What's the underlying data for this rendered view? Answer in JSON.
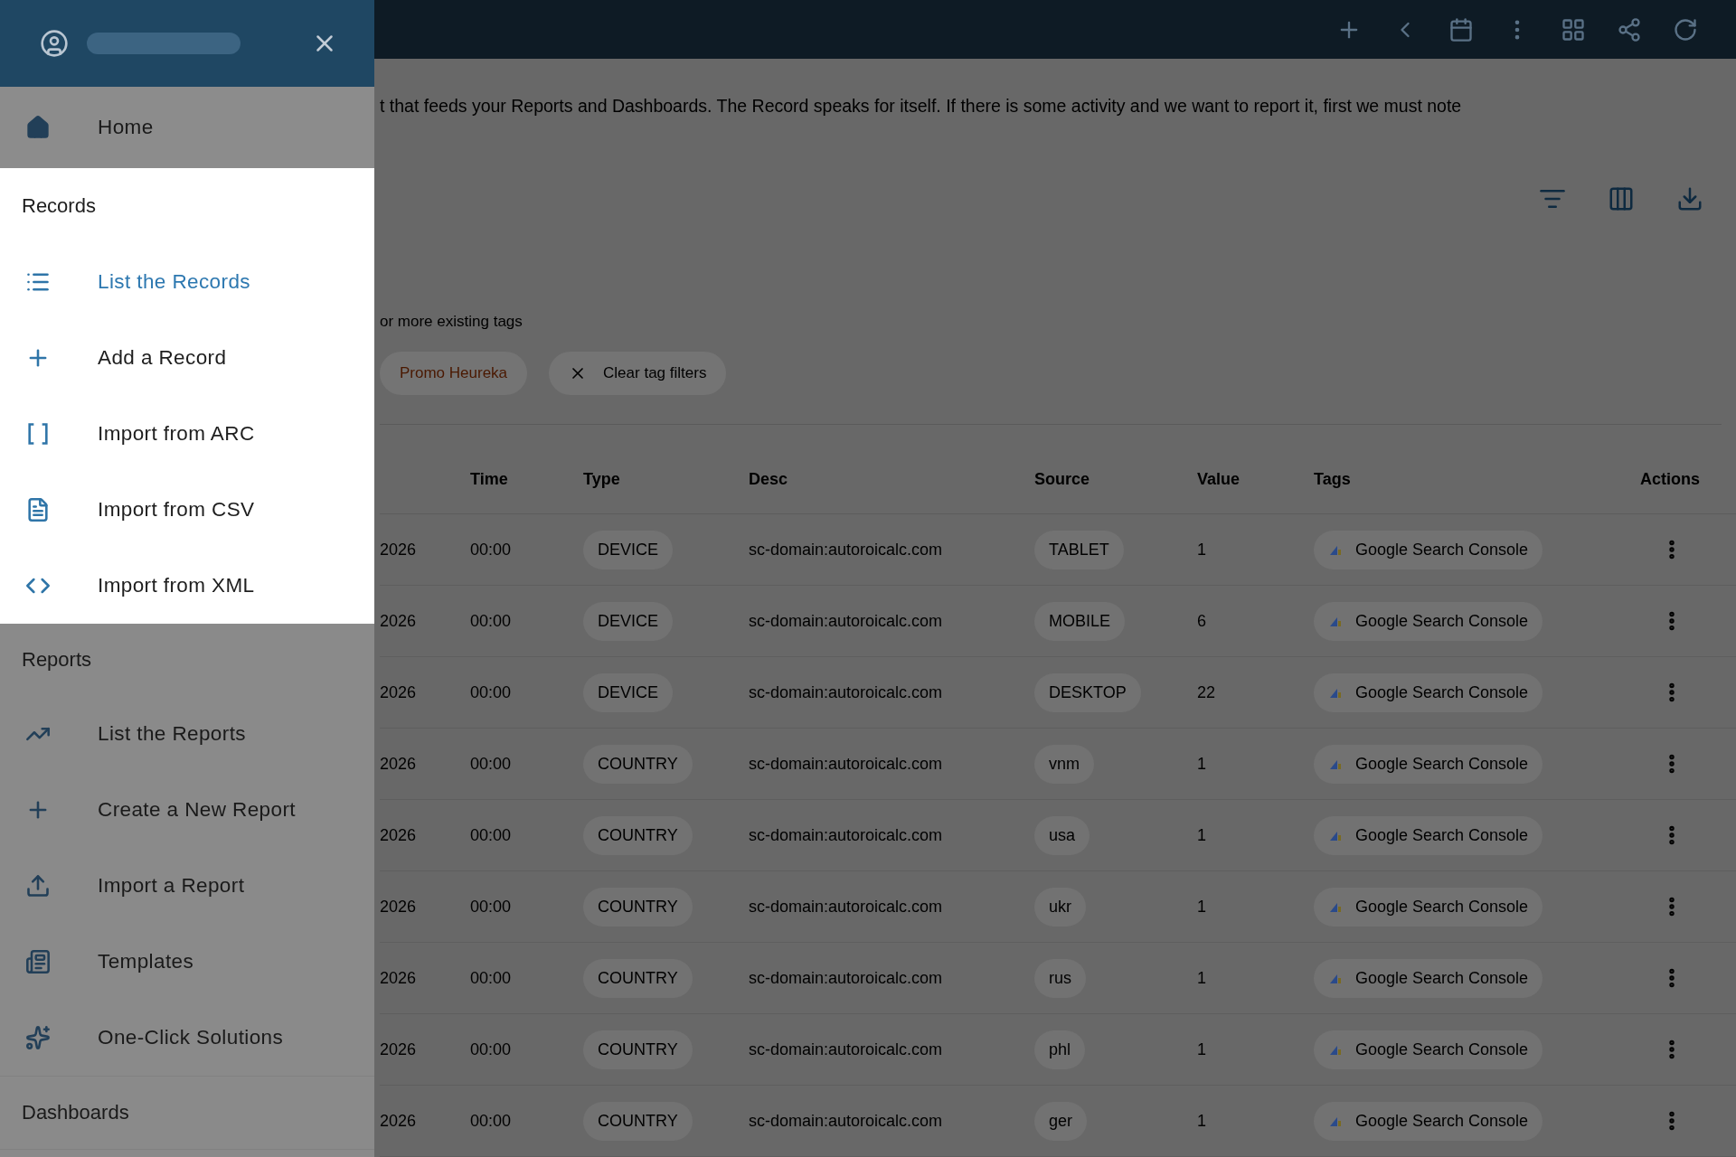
{
  "drawer": {
    "home": {
      "label": "Home",
      "selected": false
    },
    "sections": [
      {
        "title": "Records",
        "highlighted": true,
        "items": [
          {
            "label": "List the Records",
            "kind": "list",
            "selected": true
          },
          {
            "label": "Add a Record",
            "kind": "plus",
            "selected": false
          },
          {
            "label": "Import from ARC",
            "kind": "brackets",
            "selected": false
          },
          {
            "label": "Import from CSV",
            "kind": "file",
            "selected": false
          },
          {
            "label": "Import from XML",
            "kind": "code",
            "selected": false
          }
        ]
      },
      {
        "title": "Reports",
        "highlighted": false,
        "items": [
          {
            "label": "List the Reports",
            "kind": "chart",
            "selected": false
          },
          {
            "label": "Create a New Report",
            "kind": "plus",
            "selected": false
          },
          {
            "label": "Import a Report",
            "kind": "upload",
            "selected": false
          },
          {
            "label": "Templates",
            "kind": "template",
            "selected": false
          },
          {
            "label": "One-Click Solutions",
            "kind": "sparkles",
            "selected": false
          }
        ]
      },
      {
        "title": "Dashboards",
        "highlighted": false
      }
    ]
  },
  "page": {
    "intro": "t that feeds your Reports and Dashboards. The Record speaks for itself. If there is some activity and we want to report it, first we must note",
    "tags_hint": "or more existing tags",
    "tag_filters": [
      {
        "label": "Promo Heureka",
        "kind": "tag"
      },
      {
        "label": "Clear tag filters",
        "kind": "clear"
      }
    ],
    "table": {
      "columns": [
        "Time",
        "Type",
        "Desc",
        "Source",
        "Value",
        "Tags",
        "Actions"
      ],
      "rows": [
        {
          "date": "2026",
          "time": "00:00",
          "type": "DEVICE",
          "desc": "sc-domain:autoroicalc.com",
          "source": "TABLET",
          "value": "1",
          "tag": "Google Search Console"
        },
        {
          "date": "2026",
          "time": "00:00",
          "type": "DEVICE",
          "desc": "sc-domain:autoroicalc.com",
          "source": "MOBILE",
          "value": "6",
          "tag": "Google Search Console"
        },
        {
          "date": "2026",
          "time": "00:00",
          "type": "DEVICE",
          "desc": "sc-domain:autoroicalc.com",
          "source": "DESKTOP",
          "value": "22",
          "tag": "Google Search Console"
        },
        {
          "date": "2026",
          "time": "00:00",
          "type": "COUNTRY",
          "desc": "sc-domain:autoroicalc.com",
          "source": "vnm",
          "value": "1",
          "tag": "Google Search Console"
        },
        {
          "date": "2026",
          "time": "00:00",
          "type": "COUNTRY",
          "desc": "sc-domain:autoroicalc.com",
          "source": "usa",
          "value": "1",
          "tag": "Google Search Console"
        },
        {
          "date": "2026",
          "time": "00:00",
          "type": "COUNTRY",
          "desc": "sc-domain:autoroicalc.com",
          "source": "ukr",
          "value": "1",
          "tag": "Google Search Console"
        },
        {
          "date": "2026",
          "time": "00:00",
          "type": "COUNTRY",
          "desc": "sc-domain:autoroicalc.com",
          "source": "rus",
          "value": "1",
          "tag": "Google Search Console"
        },
        {
          "date": "2026",
          "time": "00:00",
          "type": "COUNTRY",
          "desc": "sc-domain:autoroicalc.com",
          "source": "phl",
          "value": "1",
          "tag": "Google Search Console"
        },
        {
          "date": "2026",
          "time": "00:00",
          "type": "COUNTRY",
          "desc": "sc-domain:autoroicalc.com",
          "source": "ger",
          "value": "1",
          "tag": "Google Search Console"
        }
      ]
    }
  }
}
